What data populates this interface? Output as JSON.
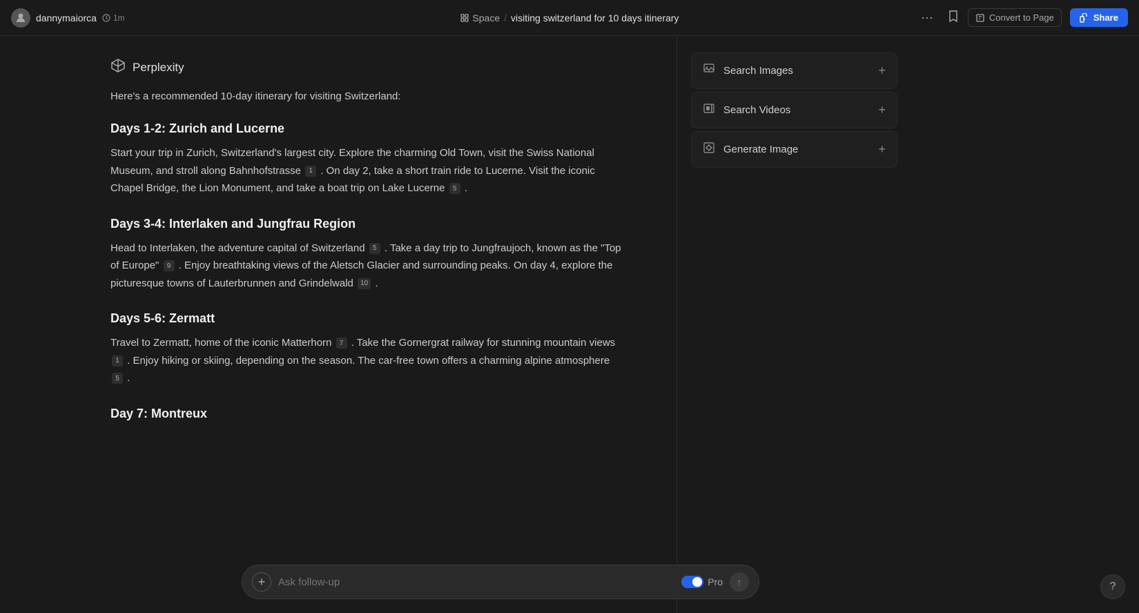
{
  "topbar": {
    "username": "dannymaiorca",
    "time": "1m",
    "clock_icon": "🕐",
    "plus_icon": "+",
    "space_label": "Space",
    "separator": "/",
    "doc_title": "visiting switzerland for 10 days itinerary",
    "dots_icon": "···",
    "bookmark_icon": "🔖",
    "convert_icon": "⧉",
    "convert_label": "Convert to Page",
    "share_icon": "🔒",
    "share_label": "Share"
  },
  "perplexity": {
    "icon": "✳",
    "label": "Perplexity"
  },
  "content": {
    "intro": "Here's a recommended 10-day itinerary for visiting Switzerland:",
    "sections": [
      {
        "heading": "Days 1-2: Zurich and Lucerne",
        "body": "Start your trip in Zurich, Switzerland's largest city. Explore the charming Old Town, visit the Swiss National Museum, and stroll along Bahnhofstrasse",
        "citations_inline": [
          {
            "position": "after_bahnhofstrasse",
            "num": "1"
          }
        ],
        "body2": ". On day 2, take a short train ride to Lucerne. Visit the iconic Chapel Bridge, the Lion Monument, and take a boat trip on Lake Lucerne",
        "citations2": [
          {
            "position": "after_lucerne",
            "num": "5"
          }
        ],
        "end": "."
      },
      {
        "heading": "Days 3-4: Interlaken and Jungfrau Region",
        "body": "Head to Interlaken, the adventure capital of Switzerland",
        "c1": "5",
        "body2": ". Take a day trip to Jungfraujoch, known as the \"Top of Europe\"",
        "c2": "9",
        "body3": ". Enjoy breathtaking views of the Aletsch Glacier and surrounding peaks. On day 4, explore the picturesque towns of Lauterbrunnen and Grindelwald",
        "c3": "10",
        "end": "."
      },
      {
        "heading": "Days 5-6: Zermatt",
        "body": "Travel to Zermatt, home of the iconic Matterhorn",
        "c1": "7",
        "body2": ". Take the Gornergrat railway for stunning mountain views",
        "c2": "1",
        "body3": ". Enjoy hiking or skiing, depending on the season. The car-free town offers a charming alpine atmosphere",
        "c3": "5",
        "end": "."
      },
      {
        "heading": "Day 7: Montreux",
        "body": ""
      }
    ]
  },
  "sidebar": {
    "items": [
      {
        "id": "search-images",
        "icon": "🖼",
        "label": "Search Images",
        "plus": "+"
      },
      {
        "id": "search-videos",
        "icon": "▦",
        "label": "Search Videos",
        "plus": "+"
      },
      {
        "id": "generate-image",
        "icon": "🖼",
        "label": "Generate Image",
        "plus": "+"
      }
    ]
  },
  "input": {
    "placeholder": "Ask follow-up",
    "pro_label": "Pro",
    "add_icon": "+",
    "send_icon": "↑"
  },
  "help": {
    "icon": "?"
  }
}
